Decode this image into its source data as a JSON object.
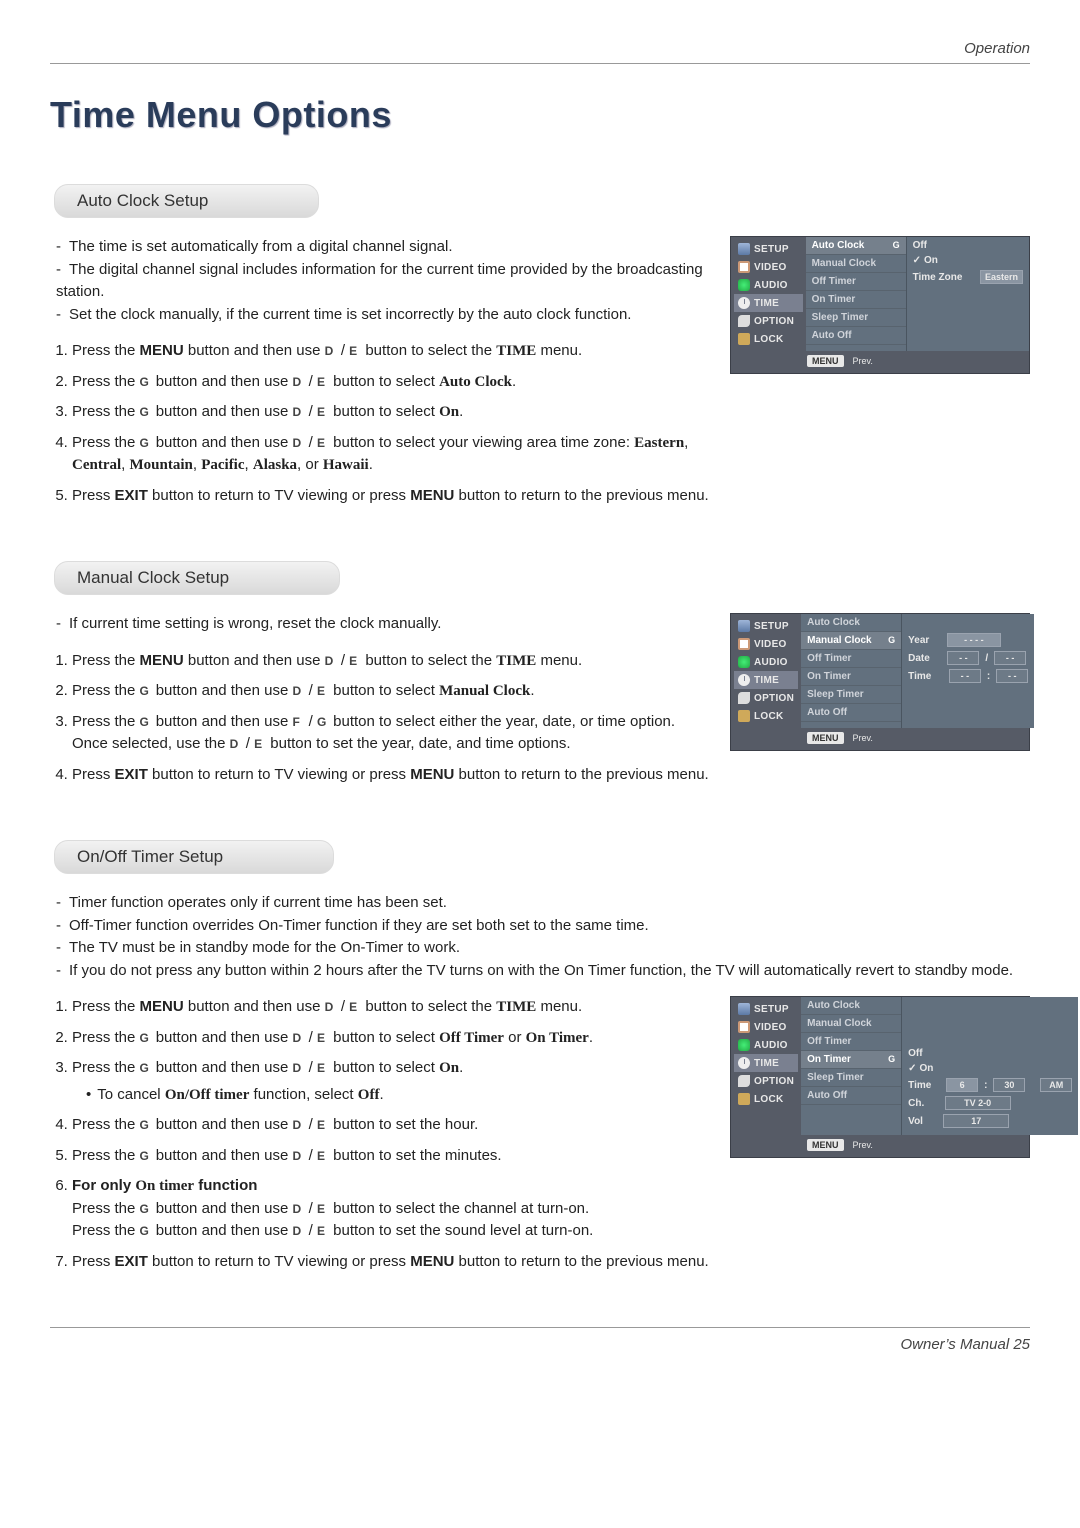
{
  "header": {
    "section": "Operation"
  },
  "page_title": "Time Menu Options",
  "buttons": {
    "d": "D",
    "e": "E",
    "g": "G",
    "f": "F",
    "menu": "MENU",
    "exit": "EXIT"
  },
  "section_a": {
    "title": "Auto Clock Setup",
    "intro": [
      "The time is set automatically from a digital channel signal.",
      "The digital channel signal includes information for the current time provided by the broadcasting station.",
      "Set the clock manually, if the current time is set incorrectly by the auto clock function."
    ],
    "steps": {
      "s1a": "Press the ",
      "s1b": " button and then use ",
      "s1c": " button to select the ",
      "s1d": "TIME",
      "s1e": " menu.",
      "s2a": "Press the ",
      "s2b": " button and then use ",
      "s2c": " button to select ",
      "s2d": "Auto Clock",
      "s2e": ".",
      "s3a": "Press the ",
      "s3b": " button and then use ",
      "s3c": " button to select ",
      "s3d": "On",
      "s3e": ".",
      "s4a": "Press the ",
      "s4b": " button and then use ",
      "s4c": " button to select your viewing area time zone: ",
      "s4d": "Eastern",
      "s4e": ", ",
      "s4f": "Central",
      "s4g": ", ",
      "s4h": "Mountain",
      "s4i": ", ",
      "s4j": "Pacific",
      "s4k": ", ",
      "s4l": "Alaska",
      "s4m": ", or ",
      "s4n": "Hawaii",
      "s4o": ".",
      "s5a": "Press ",
      "s5b": " button to return to TV viewing or press ",
      "s5c": " button to return to the previous menu."
    },
    "osd": {
      "nav": [
        "SETUP",
        "VIDEO",
        "AUDIO",
        "TIME",
        "OPTION",
        "LOCK"
      ],
      "list": [
        "Auto Clock",
        "Manual Clock",
        "Off Timer",
        "On Timer",
        "Sleep Timer",
        "Auto Off"
      ],
      "sel_index": 0,
      "right": {
        "off": "Off",
        "on": "On",
        "tz_label": "Time Zone",
        "tz_val": "Eastern"
      },
      "footer_menu": "MENU",
      "footer_prev": "Prev."
    }
  },
  "section_b": {
    "title": "Manual Clock Setup",
    "intro": [
      "If current time setting is wrong, reset the clock manually."
    ],
    "steps": {
      "s1a": "Press the ",
      "s1b": " button and then use ",
      "s1c": " button to select the ",
      "s1d": "TIME",
      "s1e": " menu.",
      "s2a": "Press the ",
      "s2b": " button and then use ",
      "s2c": " button to select ",
      "s2d": "Manual Clock",
      "s2e": ".",
      "s3a": "Press the ",
      "s3b": " button and then use ",
      "s3c": " button to select either the year, date, or time option. Once selected, use the ",
      "s3d": " button to set the year, date, and time options.",
      "s4a": "Press ",
      "s4b": " button to return to TV viewing or press ",
      "s4c": " button to return to the previous menu."
    },
    "osd": {
      "nav": [
        "SETUP",
        "VIDEO",
        "AUDIO",
        "TIME",
        "OPTION",
        "LOCK"
      ],
      "list": [
        "Auto Clock",
        "Manual Clock",
        "Off Timer",
        "On Timer",
        "Sleep Timer",
        "Auto Off"
      ],
      "sel_index": 1,
      "right": {
        "year_l": "Year",
        "year_v": "- - - -",
        "date_l": "Date",
        "date_v1": "- -",
        "date_sep": "/",
        "date_v2": "- -",
        "time_l": "Time",
        "time_v1": "- -",
        "time_sep": ":",
        "time_v2": "- -"
      },
      "footer_menu": "MENU",
      "footer_prev": "Prev."
    }
  },
  "section_c": {
    "title": "On/Off Timer Setup",
    "intro": [
      "Timer function operates only if current time has been set.",
      "Off-Timer function overrides On-Timer function if they are set both set to the same time.",
      "The TV must be in standby mode for the On-Timer to work.",
      "If you do not press any button within 2 hours after the TV turns on with the On Timer function, the TV will automatically revert to standby mode."
    ],
    "steps": {
      "s1a": "Press the ",
      "s1b": " button and then use ",
      "s1c": " button to select the ",
      "s1d": "TIME",
      "s1e": " menu.",
      "s2a": "Press the ",
      "s2b": " button and then use ",
      "s2c": " button to select ",
      "s2d": "Off Timer",
      "s2e": " or ",
      "s2f": "On Timer",
      "s2g": ".",
      "s3a": "Press the ",
      "s3b": " button and then use ",
      "s3c": " button to select ",
      "s3d": "On",
      "s3e": ".",
      "s3sub_a": "To cancel ",
      "s3sub_b": "On/Off timer",
      "s3sub_c": " function, select ",
      "s3sub_d": "Off",
      "s3sub_e": ".",
      "s4a": "Press the ",
      "s4b": " button and then use ",
      "s4c": " button to set the hour.",
      "s5a": "Press the ",
      "s5b": " button and then use ",
      "s5c": " button to set the minutes.",
      "s6h": "For only ",
      "s6hb": "On timer",
      "s6hc": " function",
      "s6la": "Press the ",
      "s6lb": " button and then use ",
      "s6lc": " button to select the channel at turn-on.",
      "s6ld": "Press the ",
      "s6le": " button and then use ",
      "s6lf": " button to set the sound level at turn-on.",
      "s7a": "Press ",
      "s7b": " button to return to TV viewing or press ",
      "s7c": " button to return to the previous menu."
    },
    "osd": {
      "nav": [
        "SETUP",
        "VIDEO",
        "AUDIO",
        "TIME",
        "OPTION",
        "LOCK"
      ],
      "list": [
        "Auto Clock",
        "Manual Clock",
        "Off Timer",
        "On Timer",
        "Sleep Timer",
        "Auto Off"
      ],
      "sel_index": 3,
      "right": {
        "off": "Off",
        "on": "On",
        "time_l": "Time",
        "time_h": "6",
        "time_sep": ":",
        "time_m": "30",
        "time_ampm": "AM",
        "ch_l": "Ch.",
        "ch_v": "TV  2-0",
        "vol_l": "Vol",
        "vol_v": "17"
      },
      "footer_menu": "MENU",
      "footer_prev": "Prev."
    }
  },
  "footer": {
    "text": "Owner’s Manual   25"
  }
}
